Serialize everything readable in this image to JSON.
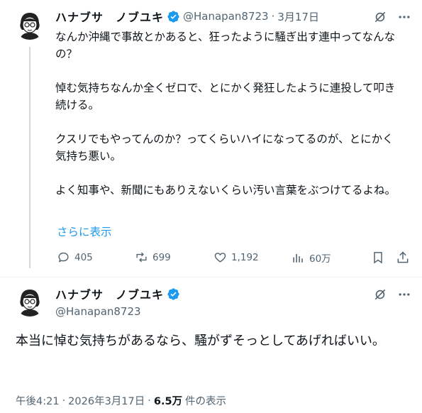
{
  "tweet1": {
    "display_name": "ハナブサ　ノブユキ",
    "handle": "@Hanapan8723",
    "separator": "·",
    "date": "3月17日",
    "text": "なんか沖縄で事故とかあると、狂ったように騒ぎ出す連中ってなんなの？\n\n悼む気持ちなんか全くゼロで、とにかく発狂したように連投して叩き続ける。\n\nクスリでもやってんのか？ってくらいハイになってるのが、とにかく気持ち悪い。\n\nよく知事や、新聞にもありえないくらい汚い言葉をぶつけてるよね。",
    "show_more": "さらに表示",
    "stats": {
      "replies": "405",
      "reposts": "699",
      "likes": "1,192",
      "views": "60万"
    }
  },
  "tweet2": {
    "display_name": "ハナブサ　ノブユキ",
    "handle": "@Hanapan8723",
    "text": "本当に悼む気持ちがあるなら、騒がずそっとしてあげればいい。",
    "footer": {
      "time": "午後4:21",
      "sep1": "·",
      "date": "2026年3月17日",
      "sep2": "·",
      "views_count": "6.5万",
      "views_label": "件の表示"
    }
  },
  "colors": {
    "accent": "#1d9bf0",
    "text": "#0f1419",
    "muted": "#536471",
    "verified": "#1d9bf0"
  },
  "icons": [
    "grok-icon",
    "more-icon",
    "reply-icon",
    "repost-icon",
    "like-icon",
    "views-icon",
    "bookmark-icon",
    "share-icon",
    "verified-icon"
  ]
}
